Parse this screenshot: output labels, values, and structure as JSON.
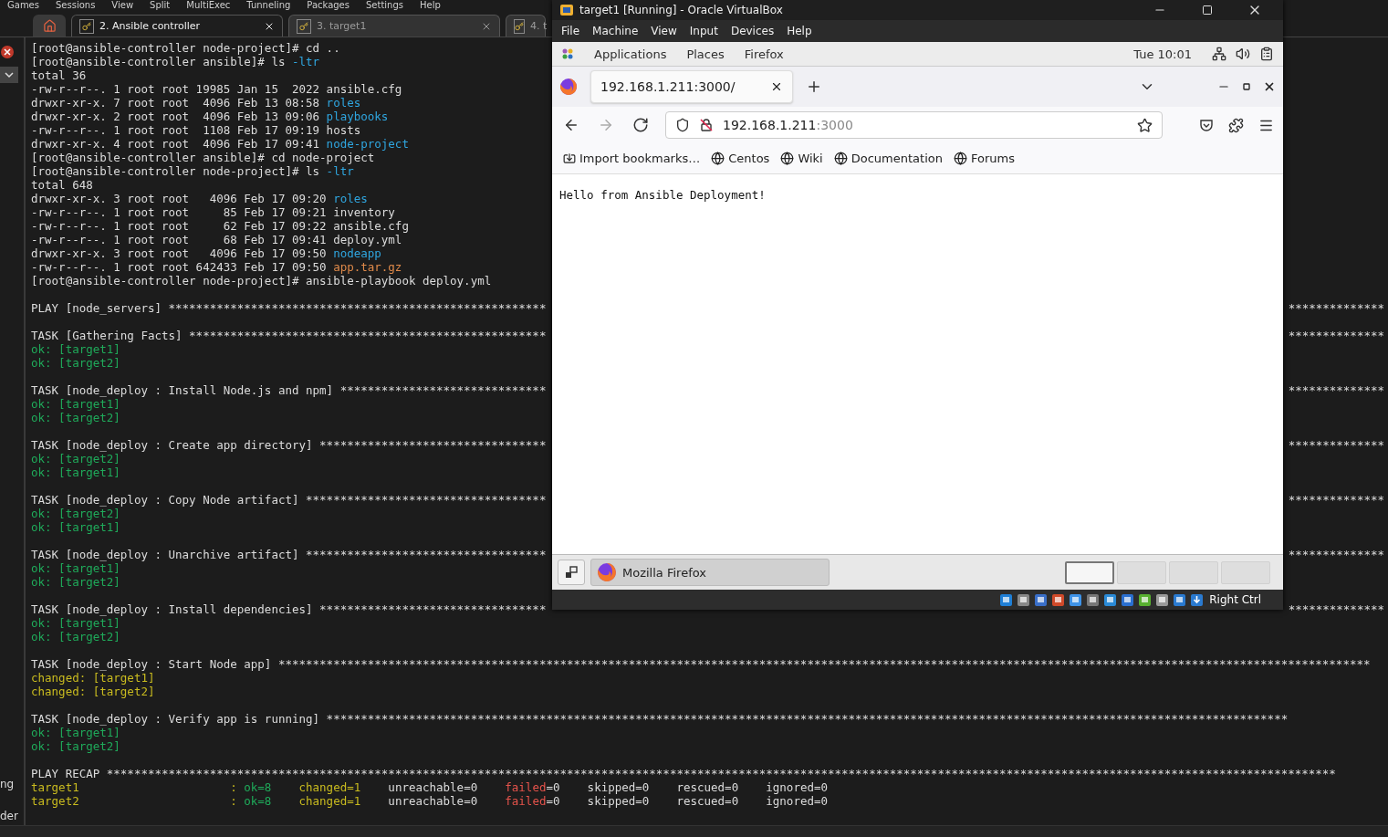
{
  "app_menu": [
    "Games",
    "Sessions",
    "View",
    "Split",
    "MultiExec",
    "Tunneling",
    "Packages",
    "Settings",
    "Help"
  ],
  "tabs": [
    {
      "label": "2. Ansible controller",
      "selected": true,
      "closable": true
    },
    {
      "label": "3. target1",
      "selected": false,
      "closable": true
    },
    {
      "label": "4. t",
      "selected": false
    }
  ],
  "sidebar": {
    "texts": [
      "ng",
      "der"
    ]
  },
  "terminal": {
    "lines": [
      {
        "kind": "text",
        "segs": [
          {
            "text": "[root@ansible-controller node-project]# cd ..",
            "color": "#dcdcdc"
          }
        ]
      },
      {
        "kind": "text",
        "segs": [
          {
            "text": "[root@ansible-controller ansible]# ls ",
            "color": "#dcdcdc"
          },
          {
            "text": "-ltr",
            "color": "#2fa6e0"
          }
        ]
      },
      {
        "kind": "text",
        "segs": [
          {
            "text": "total 36",
            "color": "#dcdcdc"
          }
        ]
      },
      {
        "kind": "text",
        "segs": [
          {
            "text": "-rw-r--r--. 1 root root 19985 Jan 15  2022 ansible.cfg",
            "color": "#dcdcdc"
          }
        ]
      },
      {
        "kind": "text",
        "segs": [
          {
            "text": "drwxr-xr-x. 7 root root  4096 Feb 13 08:58 ",
            "color": "#dcdcdc"
          },
          {
            "text": "roles",
            "color": "#2fa6e0"
          }
        ]
      },
      {
        "kind": "text",
        "segs": [
          {
            "text": "drwxr-xr-x. 2 root root  4096 Feb 13 09:06 ",
            "color": "#dcdcdc"
          },
          {
            "text": "playbooks",
            "color": "#2fa6e0"
          }
        ]
      },
      {
        "kind": "text",
        "segs": [
          {
            "text": "-rw-r--r--. 1 root root  1108 Feb 17 09:19 hosts",
            "color": "#dcdcdc"
          }
        ]
      },
      {
        "kind": "text",
        "segs": [
          {
            "text": "drwxr-xr-x. 4 root root  4096 Feb 17 09:41 ",
            "color": "#dcdcdc"
          },
          {
            "text": "node-project",
            "color": "#2fa6e0"
          }
        ]
      },
      {
        "kind": "text",
        "segs": [
          {
            "text": "[root@ansible-controller ansible]# cd node-project",
            "color": "#dcdcdc"
          }
        ]
      },
      {
        "kind": "text",
        "segs": [
          {
            "text": "[root@ansible-controller node-project]# ls ",
            "color": "#dcdcdc"
          },
          {
            "text": "-ltr",
            "color": "#2fa6e0"
          }
        ]
      },
      {
        "kind": "text",
        "segs": [
          {
            "text": "total 648",
            "color": "#dcdcdc"
          }
        ]
      },
      {
        "kind": "text",
        "segs": [
          {
            "text": "drwxr-xr-x. 3 root root   4096 Feb 17 09:20 ",
            "color": "#dcdcdc"
          },
          {
            "text": "roles",
            "color": "#2fa6e0"
          }
        ]
      },
      {
        "kind": "text",
        "segs": [
          {
            "text": "-rw-r--r--. 1 root root     85 Feb 17 09:21 inventory",
            "color": "#dcdcdc"
          }
        ]
      },
      {
        "kind": "text",
        "segs": [
          {
            "text": "-rw-r--r--. 1 root root     62 Feb 17 09:22 ansible.cfg",
            "color": "#dcdcdc"
          }
        ]
      },
      {
        "kind": "text",
        "segs": [
          {
            "text": "-rw-r--r--. 1 root root     68 Feb 17 09:41 deploy.yml",
            "color": "#dcdcdc"
          }
        ]
      },
      {
        "kind": "text",
        "segs": [
          {
            "text": "drwxr-xr-x. 3 root root   4096 Feb 17 09:50 ",
            "color": "#dcdcdc"
          },
          {
            "text": "nodeapp",
            "color": "#2fa6e0"
          }
        ]
      },
      {
        "kind": "text",
        "segs": [
          {
            "text": "-rw-r--r--. 1 root root 642433 Feb 17 09:50 ",
            "color": "#dcdcdc"
          },
          {
            "text": "app.tar.gz",
            "color": "#e08a4a"
          }
        ]
      },
      {
        "kind": "text",
        "segs": [
          {
            "text": "[root@ansible-controller node-project]# ansible-playbook deploy.yml",
            "color": "#dcdcdc"
          }
        ]
      },
      {
        "kind": "blank"
      },
      {
        "kind": "text",
        "segs": [
          {
            "text": "PLAY [node_servers] *******************************************************",
            "color": "#dcdcdc"
          }
        ],
        "tail": "**************"
      },
      {
        "kind": "blank"
      },
      {
        "kind": "text",
        "segs": [
          {
            "text": "TASK [Gathering Facts] ****************************************************",
            "color": "#dcdcdc"
          }
        ],
        "tail": "**************"
      },
      {
        "kind": "text",
        "segs": [
          {
            "text": "ok: [target1]",
            "color": "#1faa5a"
          }
        ]
      },
      {
        "kind": "text",
        "segs": [
          {
            "text": "ok: [target2]",
            "color": "#1faa5a"
          }
        ]
      },
      {
        "kind": "blank"
      },
      {
        "kind": "text",
        "segs": [
          {
            "text": "TASK [node_deploy : Install Node.js and npm] ******************************",
            "color": "#dcdcdc"
          }
        ],
        "tail": "**************"
      },
      {
        "kind": "text",
        "segs": [
          {
            "text": "ok: [target1]",
            "color": "#1faa5a"
          }
        ]
      },
      {
        "kind": "text",
        "segs": [
          {
            "text": "ok: [target2]",
            "color": "#1faa5a"
          }
        ]
      },
      {
        "kind": "blank"
      },
      {
        "kind": "text",
        "segs": [
          {
            "text": "TASK [node_deploy : Create app directory] *********************************",
            "color": "#dcdcdc"
          }
        ],
        "tail": "**************"
      },
      {
        "kind": "text",
        "segs": [
          {
            "text": "ok: [target2]",
            "color": "#1faa5a"
          }
        ]
      },
      {
        "kind": "text",
        "segs": [
          {
            "text": "ok: [target1]",
            "color": "#1faa5a"
          }
        ]
      },
      {
        "kind": "blank"
      },
      {
        "kind": "text",
        "segs": [
          {
            "text": "TASK [node_deploy : Copy Node artifact] ***********************************",
            "color": "#dcdcdc"
          }
        ],
        "tail": "**************"
      },
      {
        "kind": "text",
        "segs": [
          {
            "text": "ok: [target2]",
            "color": "#1faa5a"
          }
        ]
      },
      {
        "kind": "text",
        "segs": [
          {
            "text": "ok: [target1]",
            "color": "#1faa5a"
          }
        ]
      },
      {
        "kind": "blank"
      },
      {
        "kind": "text",
        "segs": [
          {
            "text": "TASK [node_deploy : Unarchive artifact] ***********************************",
            "color": "#dcdcdc"
          }
        ],
        "tail": "**************"
      },
      {
        "kind": "text",
        "segs": [
          {
            "text": "ok: [target1]",
            "color": "#1faa5a"
          }
        ]
      },
      {
        "kind": "text",
        "segs": [
          {
            "text": "ok: [target2]",
            "color": "#1faa5a"
          }
        ]
      },
      {
        "kind": "blank"
      },
      {
        "kind": "text",
        "segs": [
          {
            "text": "TASK [node_deploy : Install dependencies] *********************************",
            "color": "#dcdcdc"
          }
        ],
        "tail": "**************"
      },
      {
        "kind": "text",
        "segs": [
          {
            "text": "ok: [target1]",
            "color": "#1faa5a"
          }
        ]
      },
      {
        "kind": "text",
        "segs": [
          {
            "text": "ok: [target2]",
            "color": "#1faa5a"
          }
        ]
      },
      {
        "kind": "blank"
      },
      {
        "kind": "text",
        "segs": [
          {
            "text": "TASK [node_deploy : Start Node app] ***************************************************************************************************************************************************************",
            "color": "#dcdcdc"
          }
        ]
      },
      {
        "kind": "text",
        "segs": [
          {
            "text": "changed: [target1]",
            "color": "#c9bb1f"
          }
        ]
      },
      {
        "kind": "text",
        "segs": [
          {
            "text": "changed: [target2]",
            "color": "#c9bb1f"
          }
        ]
      },
      {
        "kind": "blank"
      },
      {
        "kind": "text",
        "segs": [
          {
            "text": "TASK [node_deploy : Verify app is running] ********************************************************************************************************************************************",
            "color": "#dcdcdc"
          }
        ]
      },
      {
        "kind": "text",
        "segs": [
          {
            "text": "ok: [target1]",
            "color": "#1faa5a"
          }
        ]
      },
      {
        "kind": "text",
        "segs": [
          {
            "text": "ok: [target2]",
            "color": "#1faa5a"
          }
        ]
      },
      {
        "kind": "blank"
      },
      {
        "kind": "text",
        "segs": [
          {
            "text": "PLAY RECAP ***********************************************************************************************************************************************************************************",
            "color": "#dcdcdc"
          }
        ]
      },
      {
        "kind": "text",
        "segs": [
          {
            "text": "target1                      : ",
            "color": "#c9bb1f"
          },
          {
            "text": "ok=8    ",
            "color": "#1faa5a"
          },
          {
            "text": "changed=1",
            "color": "#c9bb1f"
          },
          {
            "text": "    unreachable=0    ",
            "color": "#dcdcdc"
          },
          {
            "text": "failed",
            "color": "#e5534b"
          },
          {
            "text": "=0    skipped=0    rescued=0    ignored=0",
            "color": "#dcdcdc"
          }
        ]
      },
      {
        "kind": "text",
        "segs": [
          {
            "text": "target2                      : ",
            "color": "#c9bb1f"
          },
          {
            "text": "ok=8    ",
            "color": "#1faa5a"
          },
          {
            "text": "changed=1",
            "color": "#c9bb1f"
          },
          {
            "text": "    unreachable=0    ",
            "color": "#dcdcdc"
          },
          {
            "text": "failed",
            "color": "#e5534b"
          },
          {
            "text": "=0    skipped=0    rescued=0    ignored=0",
            "color": "#dcdcdc"
          }
        ]
      }
    ]
  },
  "vbox": {
    "title": "target1 [Running] - Oracle VirtualBox",
    "menu": [
      "File",
      "Machine",
      "View",
      "Input",
      "Devices",
      "Help"
    ],
    "guest_panel": {
      "menu": [
        "Applications",
        "Places",
        "Firefox"
      ],
      "clock": "Tue 10:01"
    },
    "firefox": {
      "tab": {
        "title": "192.168.1.211:3000/"
      },
      "nav_buttons": [
        {
          "kind": "back",
          "disabled": false
        },
        {
          "kind": "forward",
          "disabled": true
        },
        {
          "kind": "reload",
          "disabled": false
        }
      ],
      "url": {
        "host": "192.168.1.211",
        "port": ":3000"
      },
      "bookmarks": [
        {
          "label": "Import bookmarks…",
          "kind": "import"
        },
        {
          "label": "Centos",
          "kind": "site"
        },
        {
          "label": "Wiki",
          "kind": "site"
        },
        {
          "label": "Documentation",
          "kind": "site"
        },
        {
          "label": "Forums",
          "kind": "site"
        }
      ],
      "page_text": "Hello from Ansible Deployment!"
    },
    "taskbar": {
      "window": "Mozilla Firefox",
      "workspaces": [
        {
          "selected": true
        },
        {
          "selected": false
        },
        {
          "selected": false
        },
        {
          "selected": false
        }
      ]
    },
    "status": {
      "host_key": "Right Ctrl"
    }
  }
}
